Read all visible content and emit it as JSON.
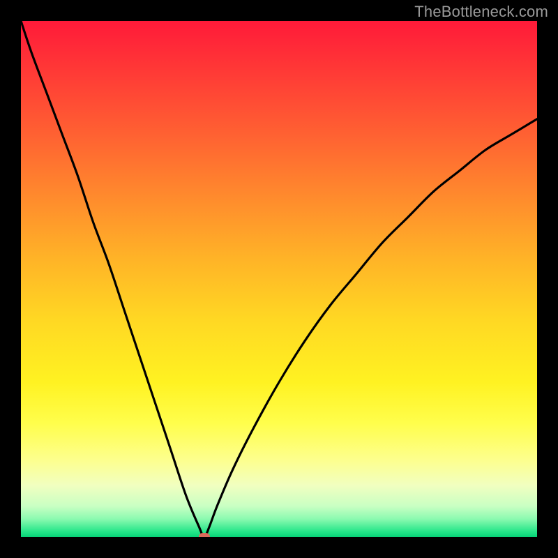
{
  "watermark": "TheBottleneck.com",
  "chart_data": {
    "type": "line",
    "title": "",
    "xlabel": "",
    "ylabel": "",
    "xlim": [
      0,
      100
    ],
    "ylim": [
      0,
      100
    ],
    "grid": false,
    "legend": false,
    "background_gradient": {
      "top": "#ff1a39",
      "middle": "#ffd823",
      "bottom": "#06d277"
    },
    "series": [
      {
        "name": "bottleneck-curve",
        "color": "#000000",
        "x": [
          0,
          2,
          5,
          8,
          11,
          14,
          17,
          20,
          23,
          26,
          29,
          32,
          34.5,
          35.5,
          36.5,
          38,
          41,
          45,
          50,
          55,
          60,
          65,
          70,
          75,
          80,
          85,
          90,
          95,
          100
        ],
        "y": [
          100,
          94,
          86,
          78,
          70,
          61,
          53,
          44,
          35,
          26,
          17,
          8,
          2,
          0,
          2,
          6,
          13,
          21,
          30,
          38,
          45,
          51,
          57,
          62,
          67,
          71,
          75,
          78,
          81
        ]
      }
    ],
    "marker": {
      "x": 35.5,
      "y": 0,
      "color": "#d96b5a"
    }
  }
}
